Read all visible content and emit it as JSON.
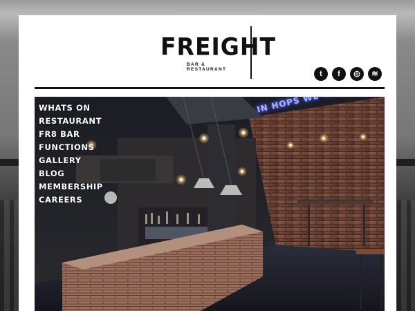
{
  "brand": {
    "name": "FREIGHT",
    "tagline": "BAR & RESTAURANT"
  },
  "social": [
    {
      "icon": "twitter-icon",
      "glyph": "t"
    },
    {
      "icon": "facebook-icon",
      "glyph": "f"
    },
    {
      "icon": "instagram-icon",
      "glyph": "◎"
    },
    {
      "icon": "rss-icon",
      "glyph": "≋"
    }
  ],
  "nav": {
    "items": [
      "WHATS ON",
      "RESTAURANT",
      "FR8 BAR",
      "FUNCTIONS",
      "GALLERY",
      "BLOG",
      "MEMBERSHIP",
      "CAREERS"
    ]
  },
  "hero": {
    "neon_sign": "IN HOPS WE TRUST",
    "colors": {
      "neon": "#7f8dff",
      "brick": "#7a4a3c",
      "dark": "#15161c"
    }
  }
}
